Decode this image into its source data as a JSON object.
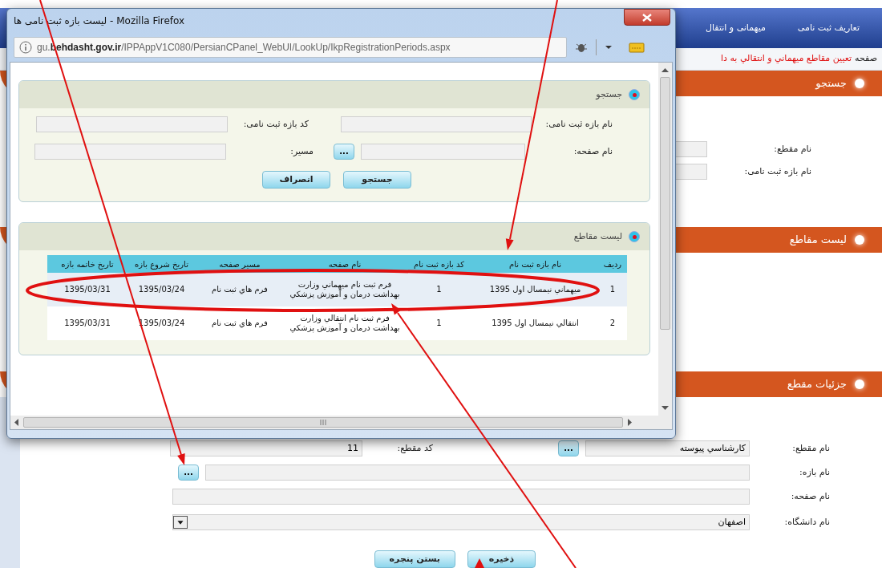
{
  "page": {
    "menu": [
      {
        "label": "تعاريف ثبت نامی"
      },
      {
        "label": "میهمانی و انتقال"
      }
    ],
    "breadcrumb": {
      "prefix": "صفحه",
      "title": "تعيين مقاطع ميهماني و انتقالي به دا"
    },
    "search_section": {
      "title": "جستجو",
      "fields": [
        {
          "label": "نام مقطع:"
        },
        {
          "label": "نام بازه ثبت نامی:"
        }
      ]
    },
    "list_section": {
      "title": "لیست مقاطع"
    },
    "details_section": {
      "title": "جزئیات مقطع",
      "degree": {
        "label": "نام مقطع:",
        "value": "کارشناسي پيوسته",
        "button": "..."
      },
      "degree_code": {
        "label": "کد مقطع:",
        "value": "11"
      },
      "period": {
        "label": "نام بازه:",
        "button": "..."
      },
      "page_name": {
        "label": "نام صفحه:"
      },
      "university": {
        "label": "نام دانشگاه:",
        "value": "اصفهان"
      },
      "buttons": [
        {
          "label": "ذخیره"
        },
        {
          "label": "بستن پنجره"
        }
      ]
    }
  },
  "popup": {
    "title": "لیست بازه ثبت نامی ها - Mozilla Firefox",
    "url": "gu.**behdasht.gov.ir**/IPPAppV1C080/PersianCPanel_WebUI/LookUp/IkpRegistrationPeriods.aspx",
    "search": {
      "title": "جستجو",
      "period_name": {
        "label": "نام بازه ثبت نامی:"
      },
      "period_code": {
        "label": "کد بازه ثبت نامی:"
      },
      "page_name": {
        "label": "نام صفحه:",
        "button": "..."
      },
      "path": {
        "label": "مسیر:"
      },
      "buttons": [
        {
          "label": "جستجو"
        },
        {
          "label": "انصراف"
        }
      ]
    },
    "list": {
      "title": "لیست مقاطع",
      "table": {
        "columns": [
          "ردیف",
          "نام بازه ثبت نام",
          "کد بازه ثبت نام",
          "نام صفحه",
          "مسیر صفحه",
          "تاریخ شروع بازه",
          "تاریخ خاتمه بازه"
        ],
        "rows": [
          {
            "selected": true,
            "cells": [
              "1",
              "ميهماني نيمسال اول 1395",
              "1",
              "فرم ثبت نام ميهماني وزارت بهداشت درمان و آموزش پزشکي",
              "فرم هاي ثبت نام",
              "1395/03/24",
              "1395/03/31"
            ]
          },
          {
            "selected": false,
            "cells": [
              "2",
              "انتقالي نيمسال اول 1395",
              "1",
              "فرم ثبت نام انتقالي وزارت بهداشت درمان و آموزش پزشکي",
              "فرم هاي ثبت نام",
              "1395/03/24",
              "1395/03/31"
            ]
          }
        ]
      }
    }
  }
}
